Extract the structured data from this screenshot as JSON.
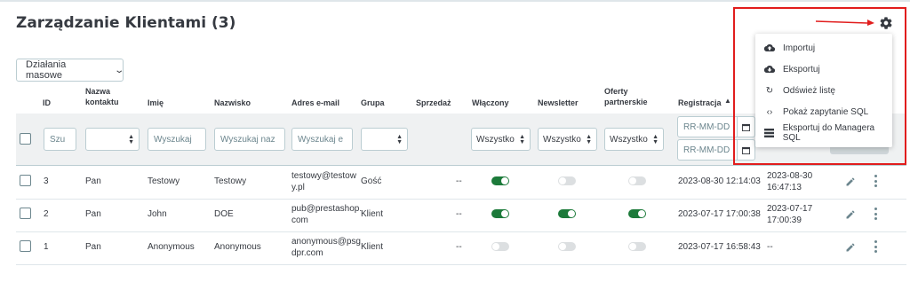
{
  "page": {
    "title": "Zarządzanie Klientami (3)"
  },
  "toolbar": {
    "bulk_actions_label": "Działania masowe"
  },
  "dropdown": {
    "items": [
      {
        "label": "Importuj",
        "icon": "cloud-upload-icon"
      },
      {
        "label": "Eksportuj",
        "icon": "cloud-download-icon"
      },
      {
        "label": "Odśwież listę",
        "icon": "refresh-icon"
      },
      {
        "label": "Pokaż zapytanie SQL",
        "icon": "code-icon"
      },
      {
        "label": "Eksportuj do Managera SQL",
        "icon": "storage-icon"
      }
    ]
  },
  "columns": {
    "id": "ID",
    "contact_name": "Nazwa kontaktu",
    "first_name": "Imię",
    "last_name": "Nazwisko",
    "email": "Adres e-mail",
    "group": "Grupa",
    "sales": "Sprzedaż",
    "enabled": "Włączony",
    "newsletter": "Newsletter",
    "partner_offers": "Oferty partnerskie",
    "registration": "Registracja"
  },
  "filters": {
    "id_placeholder": "Szu",
    "first_name_placeholder": "Wyszukaj",
    "last_name_placeholder": "Wyszukaj naz",
    "email_placeholder": "Wyszukaj e",
    "enabled_value": "Wszystko",
    "newsletter_value": "Wszystko",
    "partner_value": "Wszystko",
    "date_from_placeholder": "RR-MM-DD",
    "date_to_placeholder": "RR-MM-DD"
  },
  "rows": [
    {
      "id": "3",
      "contact": "Pan",
      "first_name": "Testowy",
      "last_name": "Testowy",
      "email_line1": "testowy@testow",
      "email_line2": "y.pl",
      "group": "Gość",
      "sales": "--",
      "enabled": true,
      "newsletter": false,
      "partner": false,
      "registered": "2023-08-30 12:14:03",
      "last_visit_line1": "2023-08-30",
      "last_visit_line2": "16:47:13"
    },
    {
      "id": "2",
      "contact": "Pan",
      "first_name": "John",
      "last_name": "DOE",
      "email_line1": "pub@prestashop.",
      "email_line2": "com",
      "group": "Klient",
      "sales": "--",
      "enabled": true,
      "newsletter": true,
      "partner": true,
      "registered": "2023-07-17 17:00:38",
      "last_visit_line1": "2023-07-17",
      "last_visit_line2": "17:00:39"
    },
    {
      "id": "1",
      "contact": "Pan",
      "first_name": "Anonymous",
      "last_name": "Anonymous",
      "email_line1": "anonymous@psg",
      "email_line2": "dpr.com",
      "group": "Klient",
      "sales": "--",
      "enabled": false,
      "newsletter": false,
      "partner": false,
      "registered": "2023-07-17 16:58:43",
      "last_visit_line1": "--",
      "last_visit_line2": ""
    }
  ],
  "colors": {
    "toggle_on": "#1c7a3a",
    "toggle_off": "#dcdfe1",
    "highlight": "#e11d1d"
  }
}
